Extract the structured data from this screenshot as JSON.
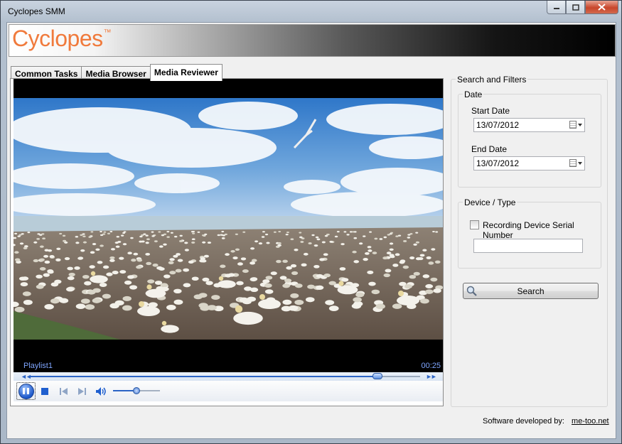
{
  "window": {
    "title": "Cyclopes SMM",
    "brand_color": "#f07a3c",
    "logo_text": "Cyclopes",
    "logo_mark": "™"
  },
  "tabs": [
    {
      "label": "Common Tasks",
      "active": false
    },
    {
      "label": "Media Browser",
      "active": false
    },
    {
      "label": "Media Reviewer",
      "active": true
    }
  ],
  "player": {
    "playlist": "Playlist1",
    "time": "00:25",
    "progress": 0.89,
    "volume": 0.5,
    "state": "playing",
    "icons": [
      "pause-icon",
      "stop-icon",
      "previous-icon",
      "next-icon",
      "volume-icon"
    ]
  },
  "search_panel": {
    "title": "Search and Filters",
    "date_group": {
      "title": "Date",
      "start_label": "Start Date",
      "start_value": "13/07/2012",
      "end_label": "End Date",
      "end_value": "13/07/2012"
    },
    "device_group": {
      "title": "Device / Type",
      "checkbox_label": "Recording Device Serial Number",
      "checked": false,
      "serial_value": ""
    },
    "search_button": "Search"
  },
  "footer": {
    "credit_label": "Software developed by:",
    "credit_link": "me-too.net"
  }
}
